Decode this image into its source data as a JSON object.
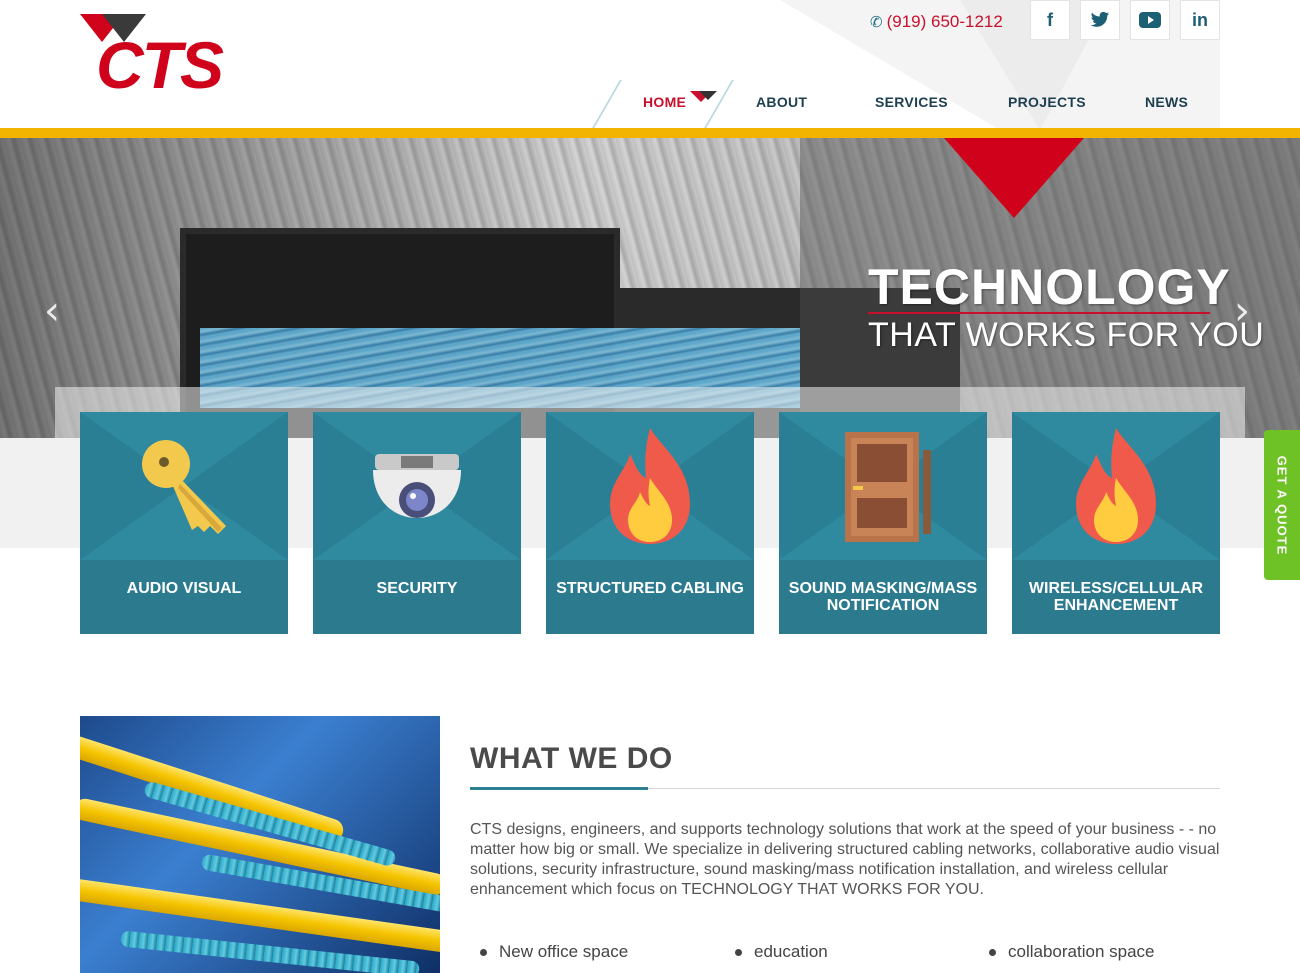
{
  "brand": {
    "logo_text": "CTS",
    "red": "#d0021b",
    "teal": "#2f8aa0",
    "yellow": "#f2b400",
    "green": "#6ec225"
  },
  "header": {
    "phone": "(919) 650-1212",
    "phone_icon": "phone-icon",
    "social": [
      {
        "name": "facebook",
        "glyph": "f"
      },
      {
        "name": "twitter",
        "glyph": "🐦"
      },
      {
        "name": "youtube",
        "glyph": "▶"
      },
      {
        "name": "linkedin",
        "glyph": "in"
      }
    ],
    "nav": [
      "HOME",
      "ABOUT",
      "SERVICES",
      "PROJECTS",
      "NEWS"
    ],
    "active_nav": "HOME"
  },
  "hero": {
    "title": "TECHNOLOGY",
    "subtitle": "THAT WORKS FOR YOU",
    "prev_arrow": "‹",
    "next_arrow": "›"
  },
  "services": [
    {
      "label": "AUDIO VISUAL",
      "icon": "key-icon"
    },
    {
      "label": "SECURITY",
      "icon": "camera-icon"
    },
    {
      "label": "STRUCTURED CABLING",
      "icon": "fire-icon"
    },
    {
      "label": "SOUND MASKING/MASS NOTIFICATION",
      "icon": "door-icon"
    },
    {
      "label": "WIRELESS/CELLULAR ENHANCEMENT",
      "icon": "fire-icon"
    }
  ],
  "quote_tab": "GET A QUOTE",
  "what_we_do": {
    "title": "WHAT WE DO",
    "body": "CTS designs, engineers, and supports technology solutions that work at the speed of your business - - no matter how big or small. We specialize in delivering structured cabling networks, collaborative audio visual solutions, security infrastructure, sound masking/mass notification installation, and wireless cellular enhancement which focus on TECHNOLOGY THAT WORKS FOR YOU.",
    "bullets": [
      "New office space",
      "education",
      "collaboration space"
    ]
  }
}
